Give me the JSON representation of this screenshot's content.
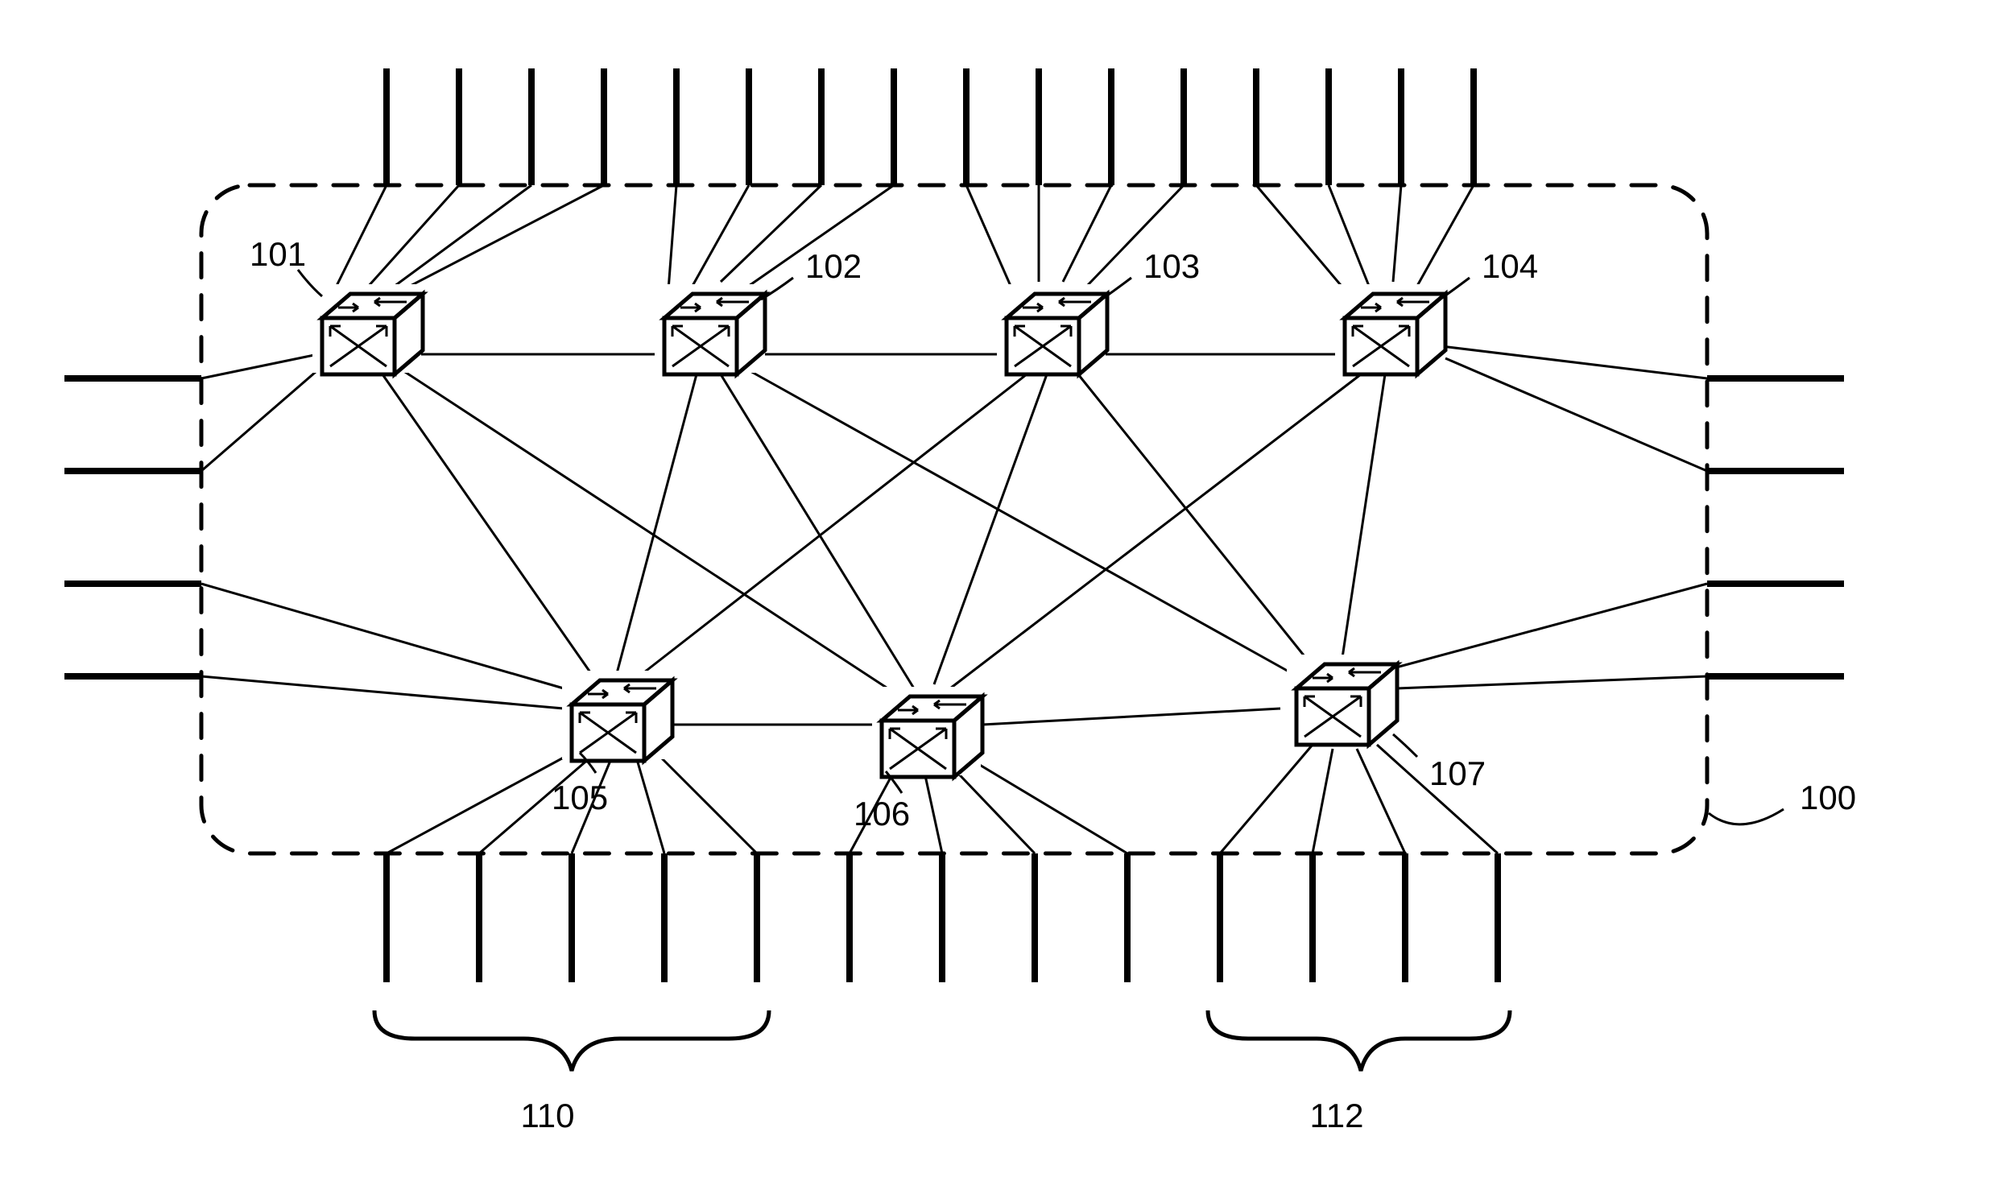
{
  "labels": {
    "box": "100",
    "node101": "101",
    "node102": "102",
    "node103": "103",
    "node104": "104",
    "node105": "105",
    "node106": "106",
    "node107": "107",
    "group110": "110",
    "group112": "112"
  }
}
